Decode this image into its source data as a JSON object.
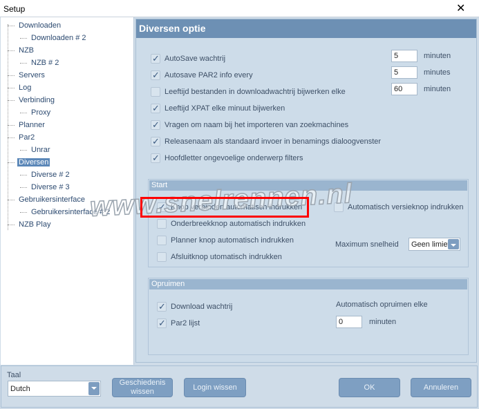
{
  "window": {
    "title": "Setup",
    "close_icon": "close-icon"
  },
  "tree": [
    {
      "label": "Downloaden",
      "level": 0
    },
    {
      "label": "Downloaden # 2",
      "level": 1
    },
    {
      "label": "NZB",
      "level": 0
    },
    {
      "label": "NZB # 2",
      "level": 1
    },
    {
      "label": "Servers",
      "level": 0
    },
    {
      "label": "Log",
      "level": 0
    },
    {
      "label": "Verbinding",
      "level": 0
    },
    {
      "label": "Proxy",
      "level": 1
    },
    {
      "label": "Planner",
      "level": 0
    },
    {
      "label": "Par2",
      "level": 0
    },
    {
      "label": "Unrar",
      "level": 1
    },
    {
      "label": "Diversen",
      "level": 0,
      "selected": true
    },
    {
      "label": "Diverse # 2",
      "level": 1
    },
    {
      "label": "Diverse # 3",
      "level": 1
    },
    {
      "label": "Gebruikersinterface",
      "level": 0
    },
    {
      "label": "Gebruikersinterface # 2",
      "level": 1
    },
    {
      "label": "NZB Play",
      "level": 0
    }
  ],
  "main": {
    "title": "Diversen optie",
    "options": [
      {
        "label": "AutoSave wachtrij",
        "checked": true,
        "value": "5",
        "unit": "minuten"
      },
      {
        "label": "Autosave PAR2 info every",
        "checked": true,
        "value": "5",
        "unit": "minutes"
      },
      {
        "label": "Leeftijd bestanden in downloadwachtrij bijwerken elke",
        "checked": false,
        "value": "60",
        "unit": "minuten"
      },
      {
        "label": "Leeftijd XPAT elke minuut bijwerken",
        "checked": true
      },
      {
        "label": "Vragen om naam bij het importeren van zoekmachines",
        "checked": true
      },
      {
        "label": "Releasenaam als standaard invoer in benamings dialoogvenster",
        "checked": true
      },
      {
        "label": "Hoofdletter ongevoelige onderwerp filters",
        "checked": true
      }
    ],
    "start": {
      "title": "Start",
      "items": [
        {
          "label": "Knop verbinden automatisch indrukken",
          "checked": true
        },
        {
          "label": "Onderbreekknop automatisch indrukken",
          "checked": false
        },
        {
          "label": "Planner knop automatisch indrukken",
          "checked": false
        },
        {
          "label": "Afsluitknop utomatisch indrukken",
          "checked": false
        }
      ],
      "version": {
        "label": "Automatisch versieknop indrukken",
        "checked": false
      },
      "speed_label": "Maximum snelheid",
      "speed_value": "Geen limiet"
    },
    "cleanup": {
      "title": "Opruimen",
      "items": [
        {
          "label": "Download wachtrij",
          "checked": true
        },
        {
          "label": "Par2 lijst",
          "checked": true
        }
      ],
      "auto_label": "Automatisch opruimen elke",
      "auto_value": "0",
      "auto_unit": "minuten"
    }
  },
  "bottom": {
    "language_label": "Taal",
    "language_value": "Dutch",
    "history_button": "Geschiedenis wissen",
    "login_button": "Login wissen",
    "ok_button": "OK",
    "cancel_button": "Annuleren"
  },
  "watermark": "www.snelrennen.nl",
  "colors": {
    "header": "#6d90b4",
    "selection": "#5b87b8",
    "highlight": "#ff0000"
  }
}
